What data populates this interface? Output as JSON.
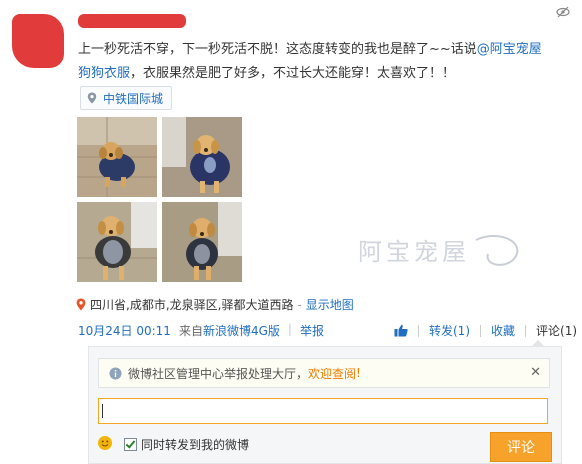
{
  "post": {
    "body_line1_prefix": "上一秒死活不穿，下一秒死活不脱！这态度转变的我也是醉了~~话说",
    "mention_line1": "@阿宝宠屋",
    "mention_line2": "狗狗衣服",
    "body_line2_suffix": "，衣服果然是肥了好多，不过长大还能穿！太喜欢了！！"
  },
  "location_tag": {
    "label": "中铁国际城",
    "icon": "location-pin-icon"
  },
  "geo": {
    "address": "四川省,成都市,龙泉驿区,驿都大道西路",
    "separator": "-",
    "map_link": "显示地图"
  },
  "meta": {
    "time": "10月24日 00:11",
    "source_prefix": "来自",
    "source": "新浪微博4G版",
    "report": "举报"
  },
  "actions": {
    "like_icon": "thumbs-up-icon",
    "repost": "转发(1)",
    "favorite": "收藏",
    "comment": "评论(1)"
  },
  "comment_panel": {
    "notice_prefix": "微博社区管理中心举报处理大厅，",
    "notice_link": "欢迎查阅",
    "notice_suffix": "!",
    "input_value": "",
    "forward_label": "同时转发到我的微博",
    "forward_checked": true,
    "submit_label": "评论"
  },
  "watermark": {
    "text": "阿宝宠屋"
  },
  "colors": {
    "link": "#1f6ebf",
    "accent": "#f7a22b",
    "notice_highlight": "#f07c00"
  }
}
